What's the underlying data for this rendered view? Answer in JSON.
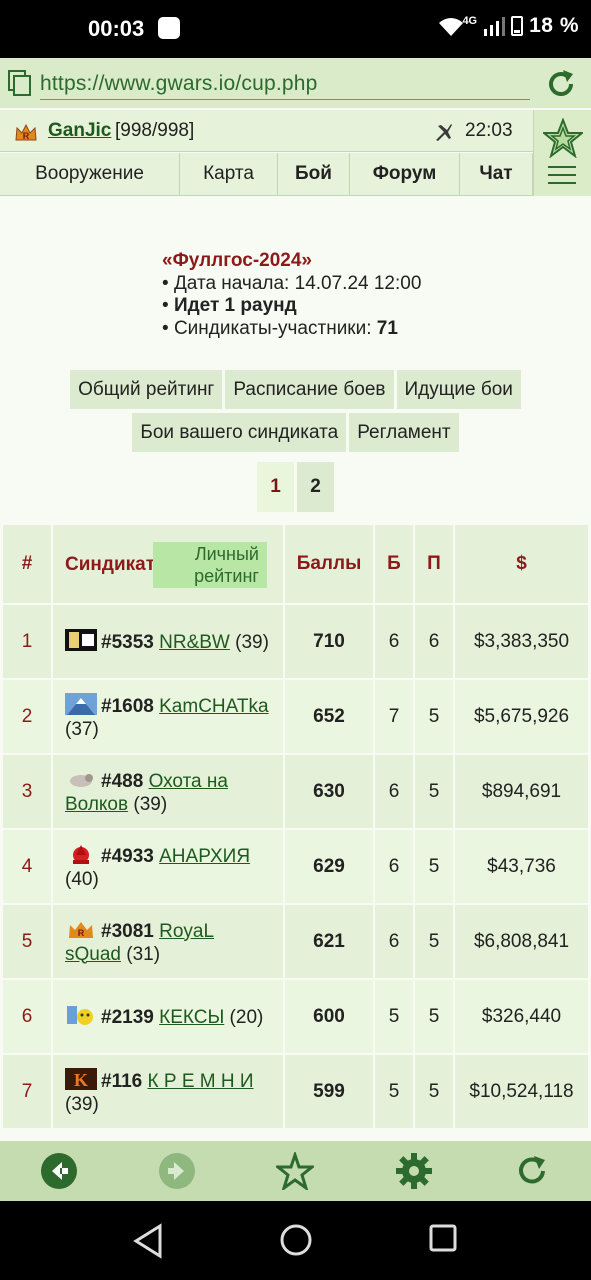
{
  "status_bar": {
    "time": "00:03",
    "network": "4G",
    "battery": "18 %"
  },
  "browser": {
    "url": "https://www.gwars.io/cup.php"
  },
  "header": {
    "username": "GanJic",
    "hp": "[998/998]",
    "clock": "22:03",
    "nav": [
      "Вооружение",
      "Карта",
      "Бой",
      "Форум",
      "Чат"
    ]
  },
  "cup": {
    "title": "«Фуллгос-2024»",
    "start_label": "Дата начала:",
    "start_value": "14.07.24 12:00",
    "round": "Идет 1 раунд",
    "participants_label": "Синдикаты-участники:",
    "participants_value": "71"
  },
  "buttons": {
    "overall_rating": "Общий рейтинг",
    "schedule": "Расписание боев",
    "ongoing": "Идущие бои",
    "your_syndicate": "Бои вашего синдиката",
    "rules": "Регламент"
  },
  "pager": [
    "1",
    "2"
  ],
  "table": {
    "headers": {
      "num": "#",
      "syndicate": "Синдикат",
      "personal_rating": "Личный рейтинг",
      "points": "Баллы",
      "b": "Б",
      "p": "П",
      "money": "$"
    },
    "rows": [
      {
        "num": "1",
        "id": "#5353",
        "name": "NR&BW",
        "members": "(39)",
        "points": "710",
        "b": "6",
        "p": "6",
        "money": "$3,383,350",
        "icon": "nrbw-emblem-icon"
      },
      {
        "num": "2",
        "id": "#1608",
        "name": "KamCHATka",
        "members": "(37)",
        "points": "652",
        "b": "7",
        "p": "5",
        "money": "$5,675,926",
        "icon": "volcano-emblem-icon"
      },
      {
        "num": "3",
        "id": "#488",
        "name": "Охота на Волков",
        "members": "(39)",
        "points": "630",
        "b": "6",
        "p": "5",
        "money": "$894,691",
        "icon": "wolf-emblem-icon"
      },
      {
        "num": "4",
        "id": "#4933",
        "name": "АНАРХИЯ",
        "members": "(40)",
        "points": "629",
        "b": "6",
        "p": "5",
        "money": "$43,736",
        "icon": "anarchy-emblem-icon"
      },
      {
        "num": "5",
        "id": "#3081",
        "name": "RoyaL sQuad",
        "members": "(31)",
        "points": "621",
        "b": "6",
        "p": "5",
        "money": "$6,808,841",
        "icon": "crown-emblem-icon"
      },
      {
        "num": "6",
        "id": "#2139",
        "name": "КЕКСЫ",
        "members": "(20)",
        "points": "600",
        "b": "5",
        "p": "5",
        "money": "$326,440",
        "icon": "keksy-emblem-icon"
      },
      {
        "num": "7",
        "id": "#116",
        "name": "К Р Е М Н И",
        "members": "(39)",
        "points": "599",
        "b": "5",
        "p": "5",
        "money": "$10,524,118",
        "icon": "k-emblem-icon"
      }
    ]
  },
  "colors": {
    "accent_red": "#8b1a1a",
    "link_green": "#1e5a1e",
    "toolbar": "#c5dcb0"
  }
}
